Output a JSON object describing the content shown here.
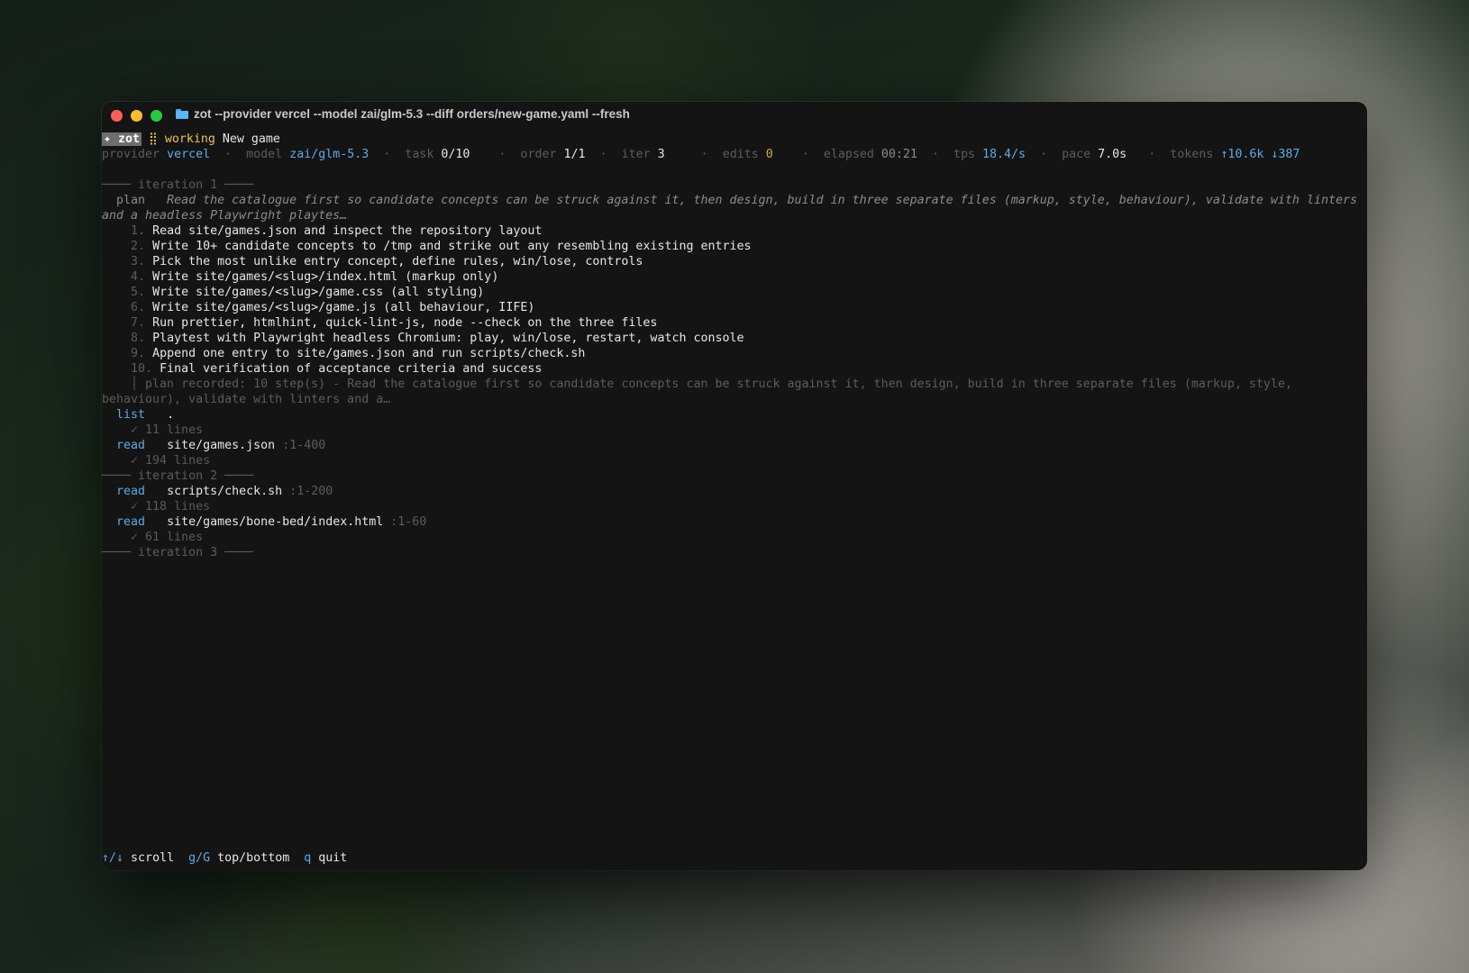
{
  "window": {
    "title": "zot --provider vercel --model zai/glm-5.3 --diff orders/new-game.yaml --fresh",
    "folder_icon": "folder-icon"
  },
  "status": {
    "badge": "✦ zot",
    "spinner": "⣿",
    "state": "working",
    "task_name": "New game"
  },
  "metrics": [
    {
      "label": "provider",
      "value": "vercel",
      "color": "blue"
    },
    {
      "label": "model",
      "value": "zai/glm-5.3",
      "color": "blue"
    },
    {
      "label": "task",
      "value": "0/10",
      "color": "white"
    },
    {
      "label": "order",
      "value": "1/1",
      "color": "white"
    },
    {
      "label": "iter",
      "value": "3",
      "color": "white"
    },
    {
      "label": "edits",
      "value": "0",
      "color": "orange"
    },
    {
      "label": "elapsed",
      "value": "00:21",
      "color": "mid"
    },
    {
      "label": "tps",
      "value": "18.4/s",
      "color": "blue"
    },
    {
      "label": "pace",
      "value": "7.0s",
      "color": "white"
    },
    {
      "label": "tokens",
      "value": "↑10.6k",
      "value2": "↓387",
      "color": "blue"
    }
  ],
  "log": {
    "iteration1": "──── iteration 1 ────",
    "plan_label": "plan",
    "plan_text": "Read the catalogue first so candidate concepts can be struck against it, then design, build in three separate files (markup, style, behaviour), validate with linters and a headless Playwright playtes…",
    "steps": [
      {
        "num": "1.",
        "text": "Read site/games.json and inspect the repository layout"
      },
      {
        "num": "2.",
        "text": "Write 10+ candidate concepts to /tmp and strike out any resembling existing entries"
      },
      {
        "num": "3.",
        "text": "Pick the most unlike entry concept, define rules, win/lose, controls"
      },
      {
        "num": "4.",
        "text": "Write site/games/<slug>/index.html (markup only)"
      },
      {
        "num": "5.",
        "text": "Write site/games/<slug>/game.css (all styling)"
      },
      {
        "num": "6.",
        "text": "Write site/games/<slug>/game.js (all behaviour, IIFE)"
      },
      {
        "num": "7.",
        "text": "Run prettier, htmlhint, quick-lint-js, node --check on the three files"
      },
      {
        "num": "8.",
        "text": "Playtest with Playwright headless Chromium: play, win/lose, restart, watch console"
      },
      {
        "num": "9.",
        "text": "Append one entry to site/games.json and run scripts/check.sh"
      },
      {
        "num": "10.",
        "text": "Final verification of acceptance criteria and success"
      }
    ],
    "plan_recorded": "│ plan recorded: 10 step(s) - Read the catalogue first so candidate concepts can be struck against it, then design, build in three separate files (markup, style, behaviour), validate with linters and a…",
    "tool_calls": [
      {
        "tool": "list",
        "arg": ".",
        "range": "",
        "result": "✓ 11 lines"
      },
      {
        "tool": "read",
        "arg": "site/games.json",
        "range": ":1-400",
        "result": "✓ 194 lines"
      }
    ],
    "iteration2": "──── iteration 2 ────",
    "tool_calls2": [
      {
        "tool": "read",
        "arg": "scripts/check.sh",
        "range": ":1-200",
        "result": "✓ 118 lines"
      },
      {
        "tool": "read",
        "arg": "site/games/bone-bed/index.html",
        "range": ":1-60",
        "result": "✓ 61 lines"
      }
    ],
    "iteration3": "──── iteration 3 ────"
  },
  "footer": {
    "scroll_key": "↑/↓",
    "scroll_label": "scroll",
    "top_key": "g/G",
    "top_label": "top/bottom",
    "quit_key": "q",
    "quit_label": "quit"
  }
}
